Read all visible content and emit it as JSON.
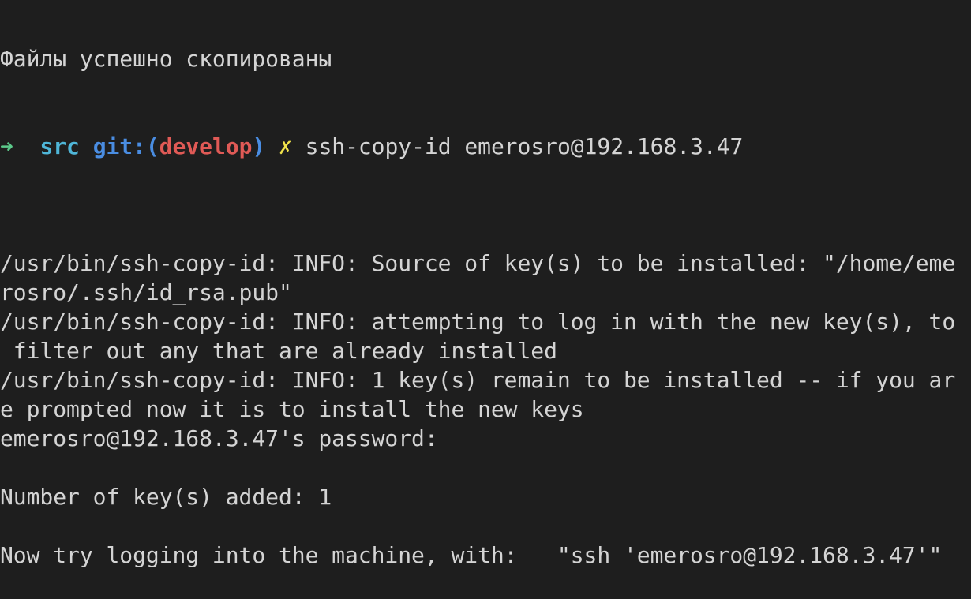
{
  "colors": {
    "background": "#1e1e1e",
    "text": "#d4d4d4",
    "prompt_arrow": "#5cc98a",
    "prompt_dir": "#4fb6d8",
    "prompt_git": "#4a8de2",
    "prompt_branch": "#e05a56",
    "prompt_dirty": "#f0e24a"
  },
  "terminal": {
    "previous_output": "Файлы успешно скопированы",
    "prompt": {
      "arrow": "➜",
      "dir": "src",
      "git_label": "git:(",
      "branch": "develop",
      "git_close": ")",
      "dirty_mark": "✗",
      "command": "ssh-copy-id emerosro@192.168.3.47"
    },
    "output_lines": [
      "",
      "/usr/bin/ssh-copy-id: INFO: Source of key(s) to be installed: \"/home/eme",
      "rosro/.ssh/id_rsa.pub\"",
      "/usr/bin/ssh-copy-id: INFO: attempting to log in with the new key(s), to",
      " filter out any that are already installed",
      "/usr/bin/ssh-copy-id: INFO: 1 key(s) remain to be installed -- if you ar",
      "e prompted now it is to install the new keys",
      "emerosro@192.168.3.47's password:",
      "",
      "Number of key(s) added: 1",
      "",
      "Now try logging into the machine, with:   \"ssh 'emerosro@192.168.3.47'\""
    ]
  }
}
